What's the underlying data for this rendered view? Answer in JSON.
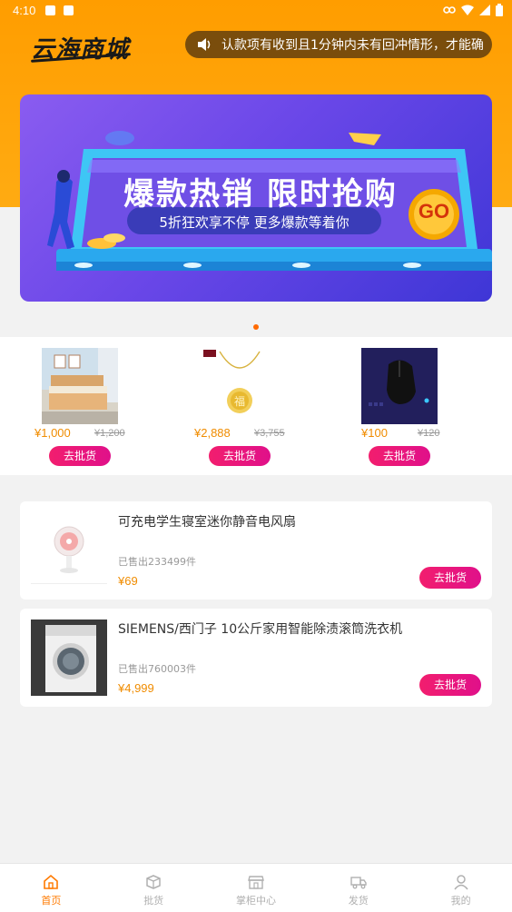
{
  "status_bar": {
    "time": "4:10"
  },
  "header": {
    "logo_text": "云海商城",
    "notice_text": "认款项有收到且1分钟内未有回冲情形，才能确"
  },
  "banner": {
    "headline": "爆款热销 限时抢购",
    "subline": "5折狂欢享不停 更多爆款等着你",
    "go_label": "GO"
  },
  "featured": [
    {
      "price": "¥1,000",
      "old_price": "¥1,200",
      "button": "去批货",
      "image": "bed-image"
    },
    {
      "price": "¥2,888",
      "old_price": "¥3,755",
      "button": "去批货",
      "image": "necklace-image"
    },
    {
      "price": "¥100",
      "old_price": "¥120",
      "button": "去批货",
      "image": "mouse-image"
    }
  ],
  "products": [
    {
      "title": "可充电学生寝室迷你静音电风扇",
      "sold": "已售出233499件",
      "price": "¥69",
      "button": "去批货",
      "image": "fan-image"
    },
    {
      "title": "SIEMENS/西门子 10公斤家用智能除渍滚筒洗衣机",
      "sold": "已售出760003件",
      "price": "¥4,999",
      "button": "去批货",
      "image": "washer-image"
    }
  ],
  "tabbar": {
    "items": [
      {
        "label": "首页",
        "icon": "home-icon",
        "active": true
      },
      {
        "label": "批货",
        "icon": "box-icon",
        "active": false
      },
      {
        "label": "掌柜中心",
        "icon": "store-icon",
        "active": false
      },
      {
        "label": "发货",
        "icon": "truck-icon",
        "active": false
      },
      {
        "label": "我的",
        "icon": "user-icon",
        "active": false
      }
    ]
  },
  "colors": {
    "accent": "#ff9d00",
    "price": "#f08c00",
    "button": "#f21e6e",
    "active_tab": "#ff7a00"
  }
}
